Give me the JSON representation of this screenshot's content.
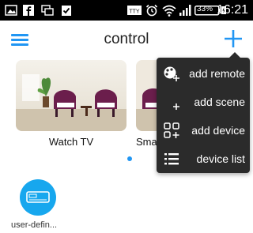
{
  "status_bar": {
    "time": "16:21",
    "battery_percent": "33%",
    "icons": [
      "image-icon",
      "facebook-icon",
      "chat-icon",
      "clipboard-check-icon",
      "tty-icon",
      "alarm-icon",
      "wifi-icon",
      "signal-icon",
      "battery-icon"
    ]
  },
  "top_bar": {
    "title": "control",
    "menu_icon": "hamburger-menu-icon",
    "add_icon": "plus-icon"
  },
  "scenes": [
    {
      "label": "Watch TV"
    },
    {
      "label": "Smart Living Room"
    }
  ],
  "pagination": {
    "pages": 2,
    "current": 1
  },
  "devices": [
    {
      "label": "user-defin...",
      "icon": "air-conditioner-icon"
    }
  ],
  "dropdown_menu": {
    "items": [
      {
        "label": "add remote",
        "icon": "remote-plus-icon"
      },
      {
        "label": "add scene",
        "icon": "scene-plus-icon"
      },
      {
        "label": "add device",
        "icon": "device-grid-plus-icon"
      },
      {
        "label": "device list",
        "icon": "list-icon"
      }
    ]
  },
  "colors": {
    "accent": "#2196f3",
    "device_circle": "#17a7ee",
    "menu_bg": "#2b2b2b",
    "status_bar_bg": "#000000"
  }
}
